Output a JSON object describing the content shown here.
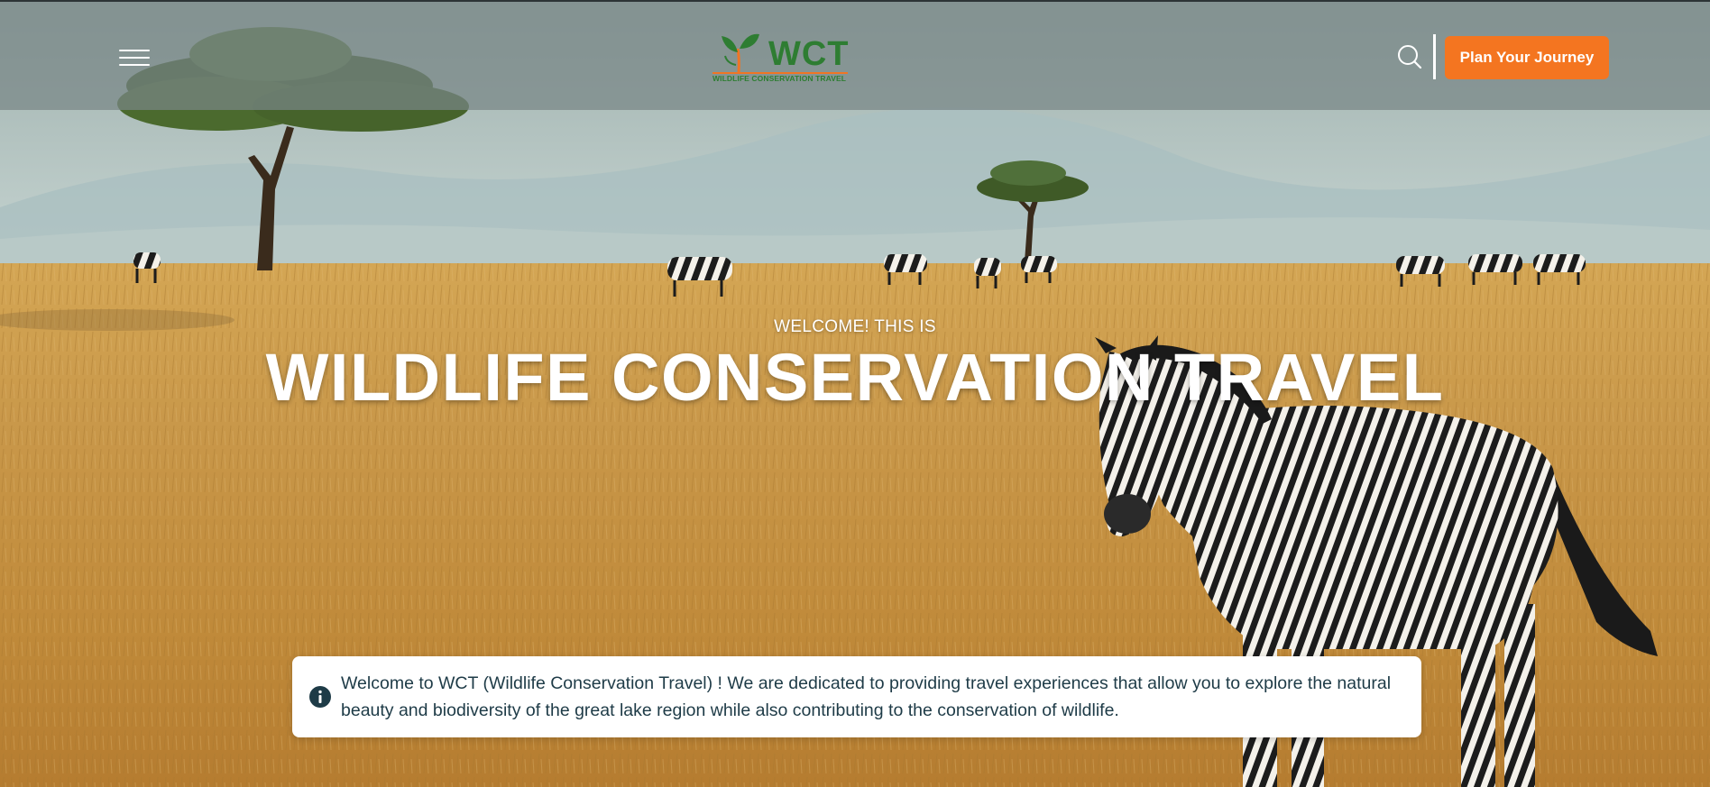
{
  "header": {
    "menu_icon": "hamburger-menu-icon",
    "logo": {
      "mark": "WCT",
      "subtitle": "WILDLIFE CONSERVATION TRAVEL",
      "icon": "sprout-leaf-icon"
    },
    "search_icon": "search-icon",
    "cta_label": "Plan Your Journey"
  },
  "hero": {
    "kicker": "WELCOME! THIS IS",
    "title": "WILDLIFE CONSERVATION TRAVEL"
  },
  "info_banner": {
    "icon": "info-icon",
    "text": "Welcome to WCT (Wildlife Conservation Travel) ! We are dedicated to providing travel experiences that allow you to explore the natural beauty and biodiversity of the great lake region while also contributing to the conservation of wildlife."
  },
  "colors": {
    "accent": "#f47520",
    "brand_green": "#2e7d32",
    "header_overlay": "#788686",
    "banner_text": "#1e3b47"
  }
}
